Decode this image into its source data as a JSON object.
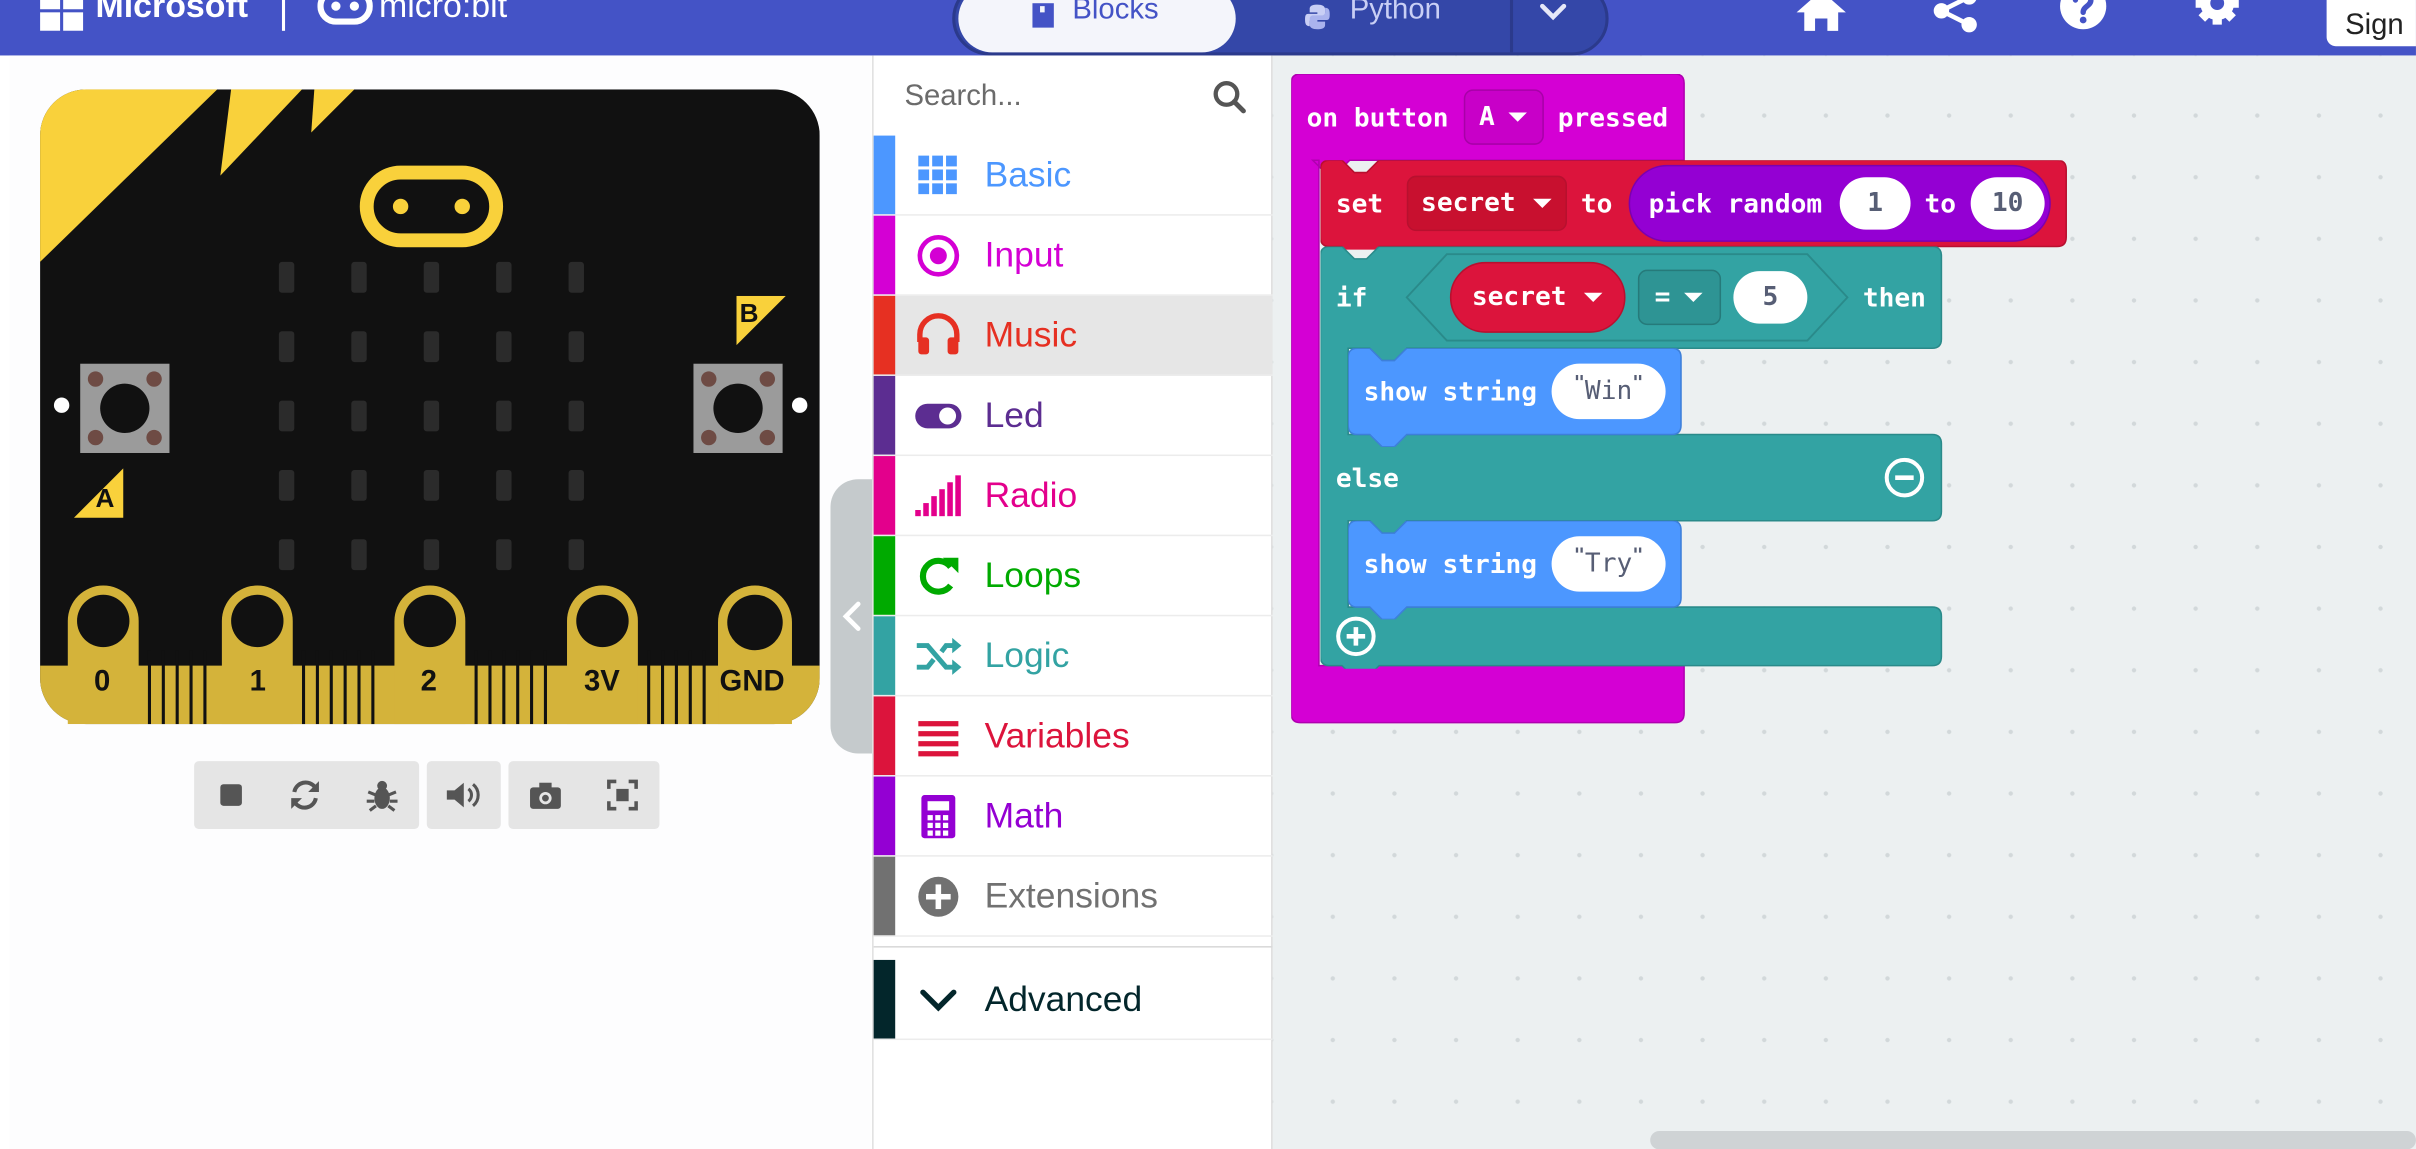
{
  "header": {
    "brand": "Microsoft",
    "product": "micro:bit",
    "tabs": [
      {
        "label": "Blocks",
        "icon": "blocks-icon",
        "active": true
      },
      {
        "label": "Python",
        "icon": "python-icon",
        "active": false
      }
    ],
    "sign_in_label": "Sign",
    "colors": {
      "bar": "#4453c6",
      "switch": "#3447a8"
    }
  },
  "simulator": {
    "pins": [
      "0",
      "1",
      "2",
      "3V",
      "GND"
    ],
    "button_a": "A",
    "button_b": "B",
    "toolbar_icons": [
      "stop-icon",
      "restart-icon",
      "debug-icon",
      "sound-icon",
      "screenshot-icon",
      "fullscreen-icon"
    ]
  },
  "toolbox": {
    "search_placeholder": "Search...",
    "categories": [
      {
        "label": "Basic",
        "color": "#4c97ff",
        "icon": "grid-icon"
      },
      {
        "label": "Input",
        "color": "#d400d4",
        "icon": "input-target-icon"
      },
      {
        "label": "Music",
        "color": "#e63022",
        "icon": "headphones-icon",
        "selected": true
      },
      {
        "label": "Led",
        "color": "#5c2d91",
        "icon": "toggle-icon"
      },
      {
        "label": "Radio",
        "color": "#e3008c",
        "icon": "signal-bars-icon"
      },
      {
        "label": "Loops",
        "color": "#00aa00",
        "icon": "loop-arrow-icon"
      },
      {
        "label": "Logic",
        "color": "#33a3a3",
        "icon": "shuffle-icon"
      },
      {
        "label": "Variables",
        "color": "#dc143c",
        "icon": "lines-icon"
      },
      {
        "label": "Math",
        "color": "#9400d3",
        "icon": "calculator-icon"
      },
      {
        "label": "Extensions",
        "color": "#717171",
        "icon": "plus-circle-icon"
      }
    ],
    "advanced": {
      "label": "Advanced",
      "color": "#03262b",
      "icon": "chevron-down-icon"
    }
  },
  "workspace": {
    "event_block": {
      "text_on": "on button",
      "button": "A",
      "text_pressed": "pressed",
      "color": "#d400d4"
    },
    "set_block": {
      "text_set": "set",
      "variable": "secret",
      "text_to": "to",
      "color": "#dc143c"
    },
    "random_block": {
      "text": "pick random",
      "from": "1",
      "text_to": "to",
      "to_value": "10",
      "color": "#9400d3"
    },
    "if_block": {
      "text_if": "if",
      "variable": "secret",
      "operator": "=",
      "compare_value": "5",
      "text_then": "then",
      "text_else": "else",
      "color": "#33a3a3"
    },
    "show_win": {
      "text": "show string",
      "value": "Win",
      "color": "#4c97ff"
    },
    "show_try": {
      "text": "show string",
      "value": "Try",
      "color": "#4c97ff"
    }
  }
}
